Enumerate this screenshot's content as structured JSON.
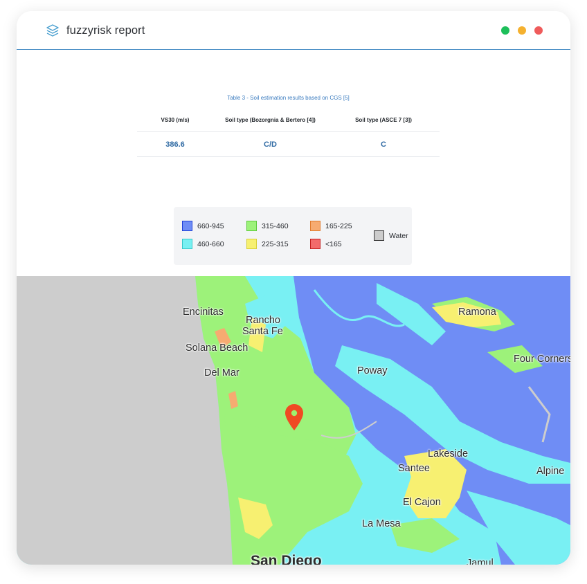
{
  "app": {
    "title": "fuzzyrisk report"
  },
  "window_controls": [
    {
      "name": "green",
      "color": "#1dbf5a"
    },
    {
      "name": "yellow",
      "color": "#f5b12f"
    },
    {
      "name": "red",
      "color": "#ef5b5b"
    }
  ],
  "table": {
    "caption": "Table 3 - Soil estimation results based on CGS [5]",
    "headers": [
      "VS30 (m/s)",
      "Soil type (Bozorgnia & Bertero [4])",
      "Soil type (ASCE 7 [3])"
    ],
    "rows": [
      [
        "386.6",
        "C/D",
        "C"
      ]
    ]
  },
  "legend": {
    "items": [
      {
        "label": "660-945",
        "color": "#6f8df5"
      },
      {
        "label": "460-660",
        "color": "#78f0f2"
      },
      {
        "label": "315-460",
        "color": "#9df27a"
      },
      {
        "label": "225-315",
        "color": "#f7f071"
      },
      {
        "label": "165-225",
        "color": "#f6ab71"
      },
      {
        "label": "<165",
        "color": "#f26b6b"
      },
      {
        "label": "Water",
        "color": "#cccccc"
      }
    ]
  },
  "map": {
    "labels": [
      "Encinitas",
      "Rancho",
      "Santa Fe",
      "Solana Beach",
      "Ramona",
      "Four Corners",
      "Del Mar",
      "Poway",
      "Lakeside",
      "Santee",
      "Alpine",
      "El Cajon",
      "La Mesa",
      "San Diego",
      "Jamul"
    ],
    "pin_color": "#f04a23"
  }
}
